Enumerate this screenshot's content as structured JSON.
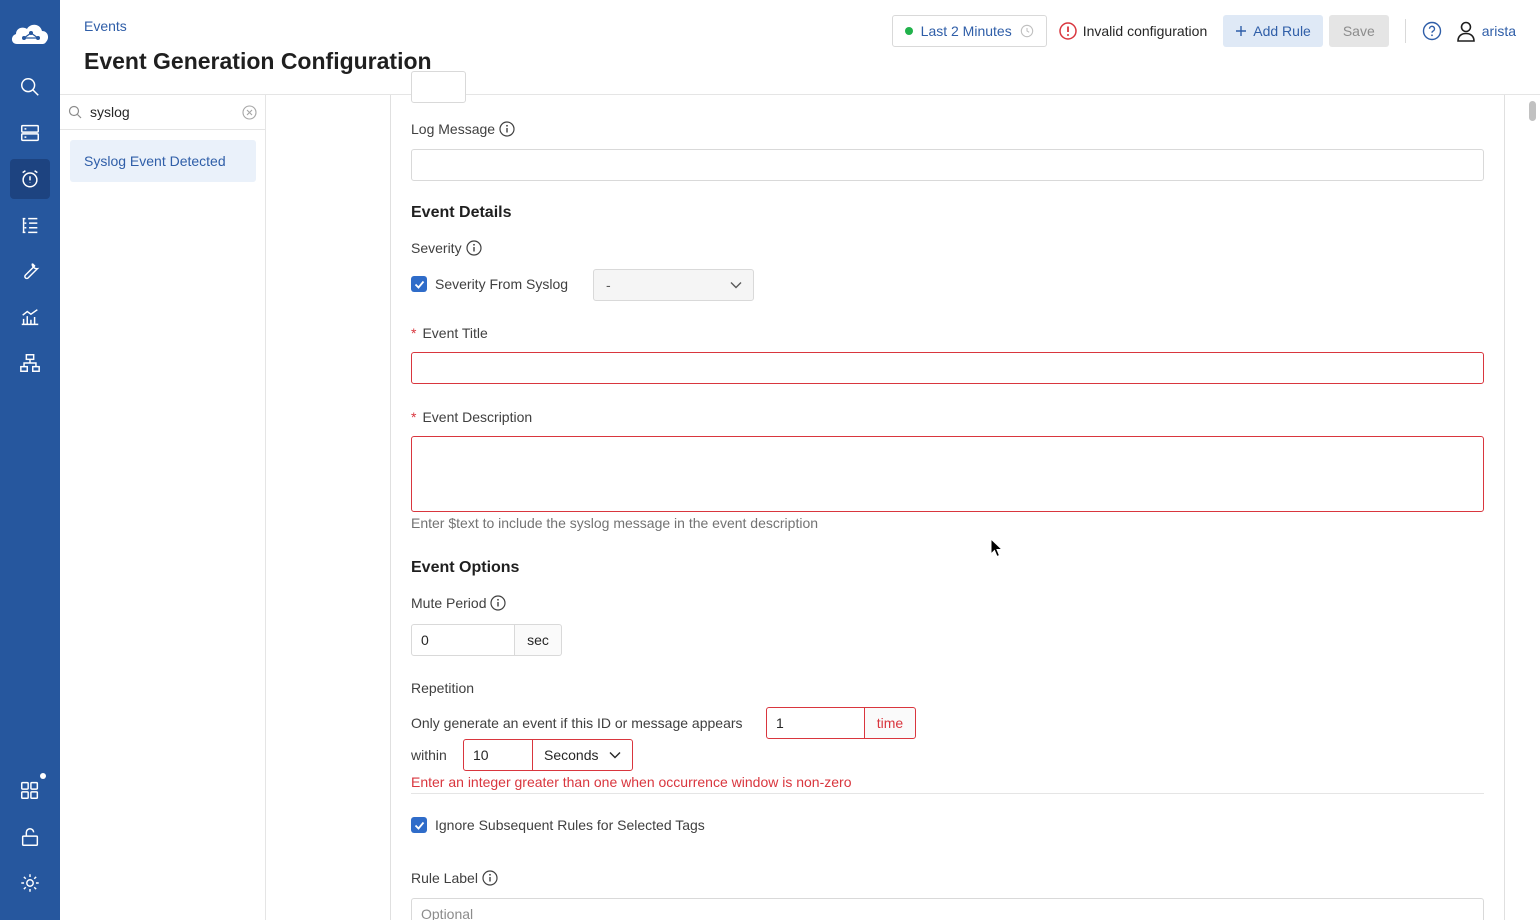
{
  "header": {
    "breadcrumb": "Events",
    "title": "Event Generation Configuration",
    "time_range": "Last 2 Minutes",
    "invalid_config": "Invalid configuration",
    "add_rule": "Add Rule",
    "save": "Save",
    "user": "arista"
  },
  "sidebar": {
    "search_value": "syslog",
    "rules": [
      "Syslog Event Detected"
    ]
  },
  "nav": [
    "cloud-logo",
    "search-icon",
    "devices-icon",
    "events-icon",
    "tasks-icon",
    "tools-icon",
    "metrics-icon",
    "topology-icon",
    "apps-icon",
    "unlock-icon",
    "settings-icon"
  ],
  "form": {
    "log_message_label": "Log Message",
    "log_message_value": "",
    "event_details_heading": "Event Details",
    "severity_label": "Severity",
    "severity_from_syslog_label": "Severity From Syslog",
    "severity_select_value": "-",
    "event_title_label": "Event Title",
    "event_title_value": "",
    "event_description_label": "Event Description",
    "event_description_value": "",
    "event_description_hint": "Enter $text to include the syslog message in the event description",
    "event_options_heading": "Event Options",
    "mute_period_label": "Mute Period",
    "mute_period_value": "0",
    "mute_period_unit": "sec",
    "repetition_label": "Repetition",
    "repetition_text": "Only generate an event if this ID or message appears",
    "repetition_count": "1",
    "repetition_unit": "time",
    "within_label": "within",
    "within_value": "10",
    "within_unit": "Seconds",
    "repetition_error": "Enter an integer greater than one when occurrence window is non-zero",
    "ignore_rules_label": "Ignore Subsequent Rules for Selected Tags",
    "rule_label_label": "Rule Label",
    "rule_label_placeholder": "Optional",
    "required_mark": "*"
  },
  "colors": {
    "rail": "#26579e",
    "accent": "#2f5ea8",
    "error": "#d9363e",
    "status_ok": "#21b24b"
  }
}
